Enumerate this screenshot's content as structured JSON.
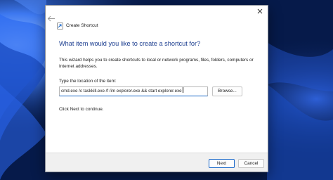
{
  "wallpaper": {
    "base_color": "#061a4a",
    "accent_color": "#2f6cf0",
    "highlight_color": "#7fb2ff"
  },
  "dialog": {
    "title": "Create Shortcut",
    "heading": "What item would you like to create a shortcut for?",
    "description": "This wizard helps you to create shortcuts to local or network programs, files, folders, computers or Internet addresses.",
    "location_label": "Type the location of the item:",
    "location_value": "cmd.exe /c taskkill.exe /f /im explorer.exe && start explorer.exe",
    "browse_label": "Browse...",
    "hint": "Click Next to continue.",
    "next_label": "Next",
    "cancel_label": "Cancel",
    "close_icon": "close-icon",
    "back_icon": "back-arrow-icon",
    "heading_color": "#1b3d8f",
    "accent_color": "#1464c8"
  }
}
